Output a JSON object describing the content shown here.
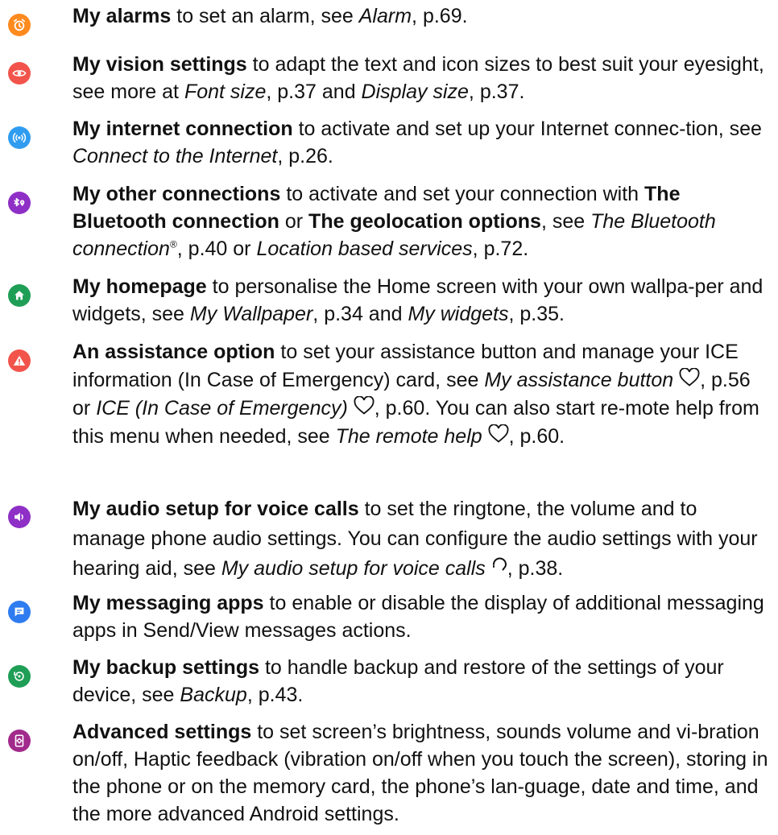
{
  "colors": {
    "orange": "#ff8a1e",
    "coral": "#f2544b",
    "blue": "#2f9cf0",
    "purple": "#8e2fc6",
    "green": "#1f9e56",
    "red": "#f2544b",
    "violet": "#8e2fc6",
    "msg_blue": "#2f7cf0",
    "backup_green": "#1f9e56",
    "magenta": "#a12a8c"
  },
  "items": [
    {
      "icon": "alarm-clock-icon",
      "title": "My alarms",
      "t1": " to set an alarm, see ",
      "r1": "Alarm",
      "t2": ", p.69."
    },
    {
      "icon": "eye-icon",
      "title": "My vision settings",
      "t1": " to adapt the text and icon sizes to best suit your eyesight, see more at ",
      "r1": "Font size",
      "t2": ", p.37 and ",
      "r2": "Display size",
      "t3": ", p.37."
    },
    {
      "icon": "wifi-signal-icon",
      "title": "My internet connection",
      "t1": " to activate and set up your Internet connec-tion, see ",
      "r1": "Connect to the Internet",
      "t2": ", p.26."
    },
    {
      "icon": "bluetooth-location-icon",
      "title": "My other connections",
      "t1": " to activate and set your connection with ",
      "b1": "The Bluetooth connection",
      "t2": " or ",
      "b2": "The geolocation options",
      "t3": ", see ",
      "r1": "The Bluetooth connection",
      "sup": "®",
      "t4": ", p.40 or ",
      "r2": "Location based services",
      "t5": ", p.72."
    },
    {
      "icon": "home-icon",
      "title": "My homepage",
      "t1": " to personalise the Home screen with your own wallpa-per and widgets, see ",
      "r1": "My Wallpaper",
      "t2": ", p.34 and ",
      "r2": "My widgets",
      "t3": ", p.35."
    },
    {
      "icon": "warning-icon",
      "title": "An assistance option",
      "t1": " to set your assistance button and manage your ICE information (In Case of Emergency) card, see ",
      "r1": "My assistance button",
      "t2": ", p.56 or ",
      "r2": "ICE (In Case of Emergency)",
      "t3": ", p.60. You can also start re-mote help from this menu when needed, see ",
      "r3": "The remote help",
      "t4": ", p.60."
    },
    {
      "icon": "speaker-icon",
      "title": "My audio setup for voice calls",
      "t1": " to set the ringtone, the volume and to manage phone audio settings. You can configure the audio settings with your hearing aid, see ",
      "r1": "My audio setup for voice calls",
      "t2": ", p.38."
    },
    {
      "icon": "message-icon",
      "title": "My messaging apps",
      "t1": " to enable or disable the display of additional messaging apps in Send/View messages actions."
    },
    {
      "icon": "backup-restore-icon",
      "title": "My backup settings",
      "t1": " to handle backup and restore of the settings of your device, see ",
      "r1": "Backup",
      "t2": ", p.43."
    },
    {
      "icon": "settings-phone-icon",
      "title": "Advanced settings",
      "t1": " to set screen’s brightness, sounds volume and vi-bration on/off, Haptic feedback (vibration on/off when you touch the screen), storing in the phone or on the memory card, the phone’s lan-guage, date and time, and the more advanced Android settings."
    }
  ]
}
